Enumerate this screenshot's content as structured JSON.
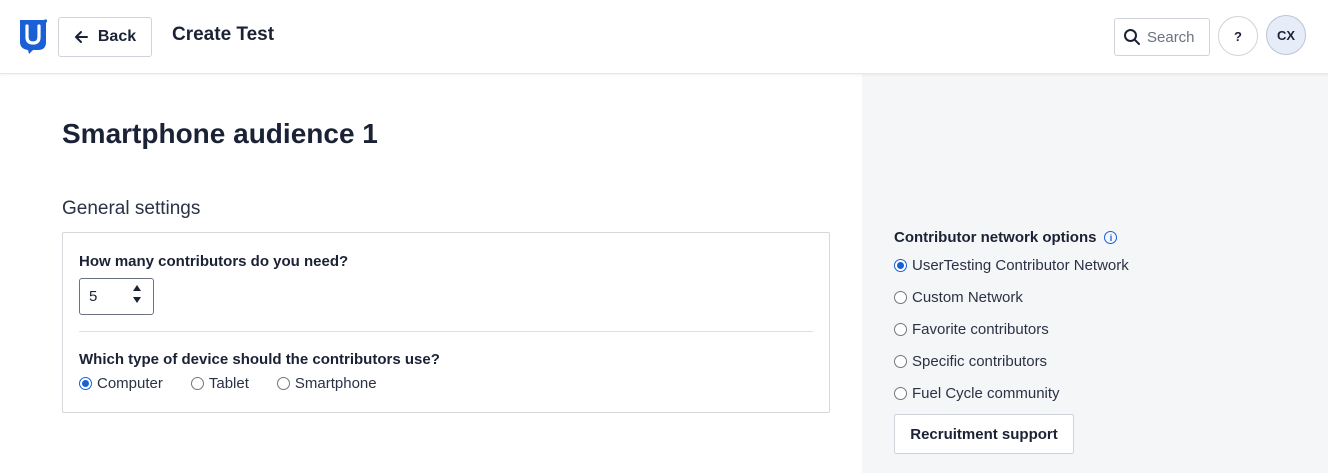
{
  "header": {
    "back_label": "Back",
    "page_title": "Create Test",
    "search_placeholder": "Search",
    "help_label": "?",
    "avatar_initials": "CX"
  },
  "main": {
    "audience_title": "Smartphone audience 1",
    "section_label": "General settings",
    "contributors_question": "How many contributors do you need?",
    "contributors_value": "5",
    "device_question": "Which type of device should the contributors use?",
    "device_options": [
      {
        "label": "Computer",
        "checked": true
      },
      {
        "label": "Tablet",
        "checked": false
      },
      {
        "label": "Smartphone",
        "checked": false
      }
    ]
  },
  "right_panel": {
    "network_title": "Contributor network options",
    "network_options": [
      {
        "label": "UserTesting Contributor Network",
        "checked": true
      },
      {
        "label": "Custom Network",
        "checked": false
      },
      {
        "label": "Favorite contributors",
        "checked": false
      },
      {
        "label": "Specific contributors",
        "checked": false
      },
      {
        "label": "Fuel Cycle community",
        "checked": false
      }
    ],
    "recruitment_label": "Recruitment support"
  },
  "colors": {
    "brand": "#1a5fd6",
    "text": "#1b2235",
    "panel_bg": "#f5f6f8"
  }
}
